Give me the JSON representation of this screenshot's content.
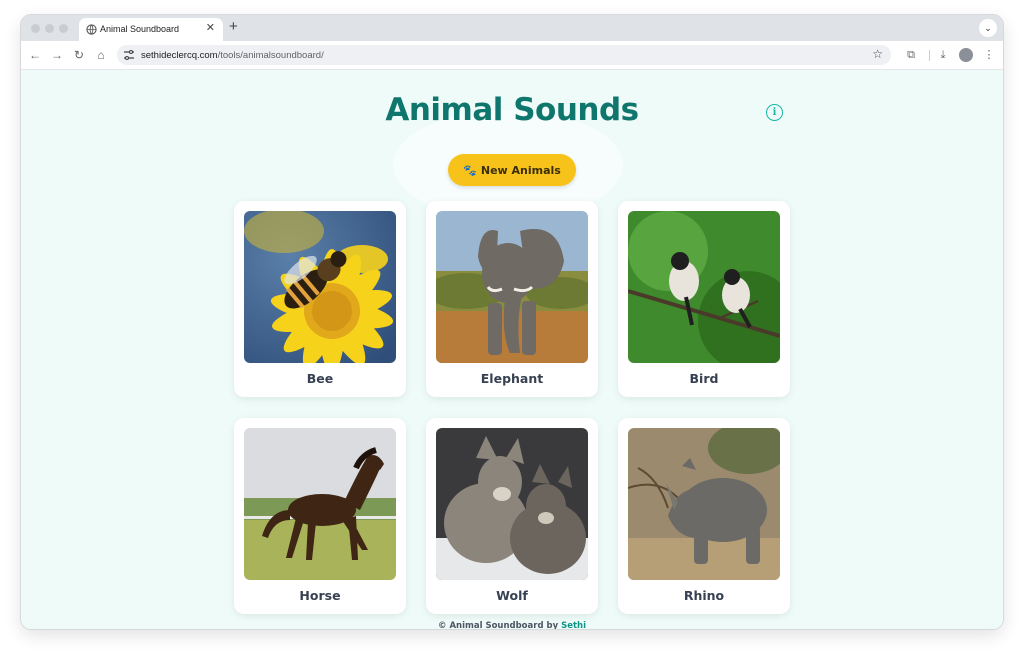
{
  "browser": {
    "tab_title": "Animal Soundboard",
    "tab_close": "✕",
    "new_tab": "+",
    "url_domain": "sethideclercq.com",
    "url_path": "/tools/animalsoundboard/"
  },
  "page": {
    "heading": "Animal Sounds",
    "new_button_icon": "🐾",
    "new_button_label": "New Animals",
    "info_icon": "i",
    "animals": [
      {
        "name": "Bee"
      },
      {
        "name": "Elephant"
      },
      {
        "name": "Bird"
      },
      {
        "name": "Horse"
      },
      {
        "name": "Wolf"
      },
      {
        "name": "Rhino"
      }
    ],
    "footer_prefix": "© Animal Soundboard by",
    "footer_author": "Sethi"
  },
  "colors": {
    "heading": "#0f766e",
    "button": "#f7c31a",
    "accent": "#14b8a6",
    "page_bg": "#effbf8"
  }
}
